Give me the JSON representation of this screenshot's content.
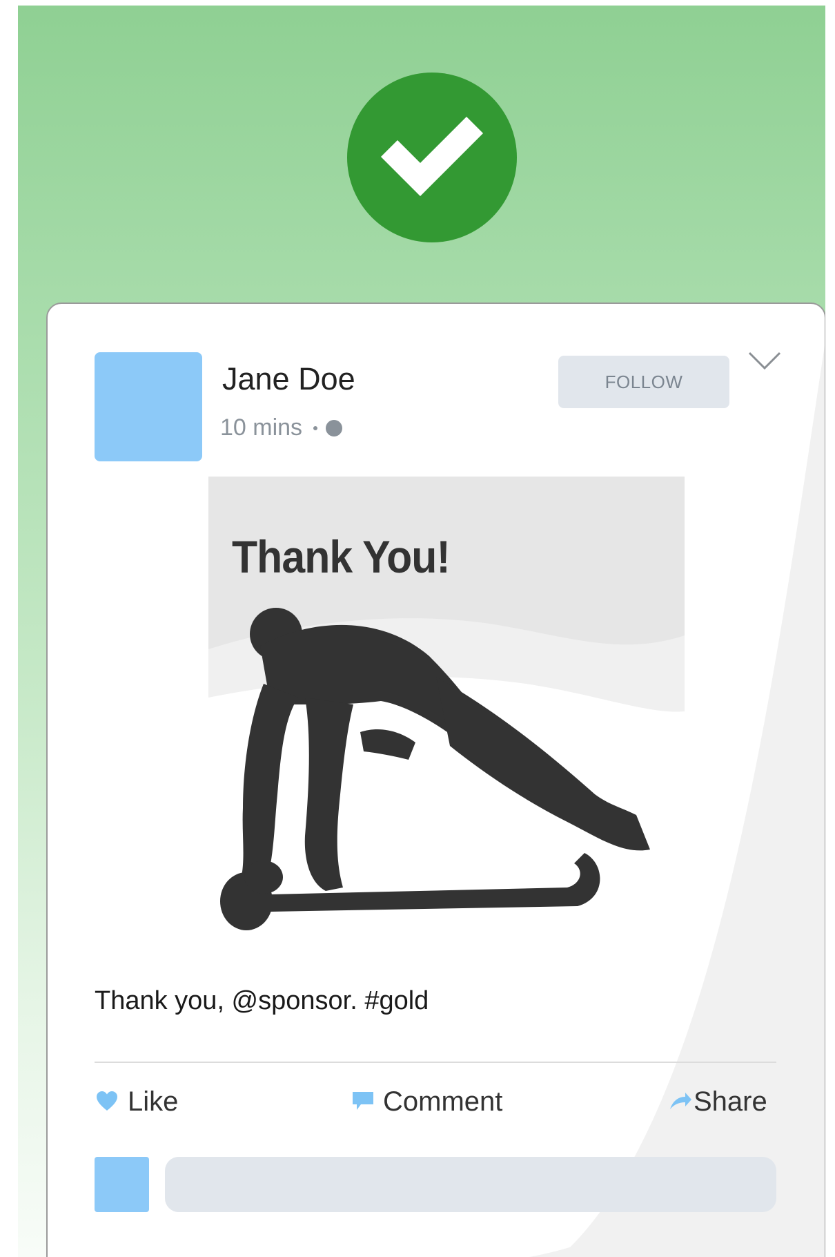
{
  "theme": {
    "background_gradient": [
      "#8fd093",
      "#f8fcf8"
    ],
    "check_color": "#339933",
    "avatar_color": "#8cc9f8",
    "button_bg": "#e1e6ec",
    "like_icon_color": "#7dc3f5"
  },
  "success_badge": {
    "icon": "checkmark-icon"
  },
  "post": {
    "author": "Jane Doe",
    "timestamp": "10 mins",
    "visibility_icon": "globe-icon",
    "follow_label": "FOLLOW",
    "menu_icon": "chevron-down-icon",
    "image": {
      "title": "Thank You!",
      "icon": "field-hockey-player-silhouette"
    },
    "caption": "Thank you, @sponsor. #gold",
    "actions": {
      "like": {
        "label": "Like",
        "icon": "heart-icon"
      },
      "comment": {
        "label": "Comment",
        "icon": "speech-bubble-icon"
      },
      "share": {
        "label": "Share",
        "icon": "share-arrow-icon"
      }
    },
    "comment_box": {
      "placeholder": "",
      "value": ""
    }
  }
}
